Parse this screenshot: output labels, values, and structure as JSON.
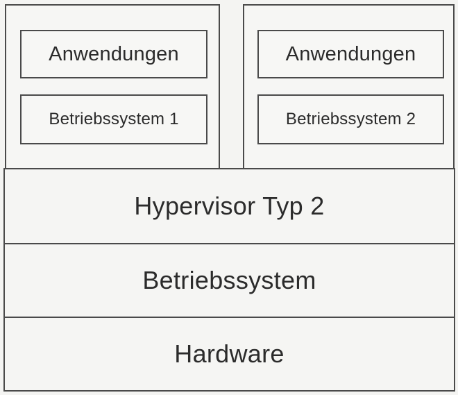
{
  "vm1": {
    "apps_label": "Anwendungen",
    "os_label": "Betriebssystem 1"
  },
  "vm2": {
    "apps_label": "Anwendungen",
    "os_label": "Betriebssystem 2"
  },
  "layers": {
    "hypervisor": "Hypervisor Typ 2",
    "host_os": "Betriebssystem",
    "hardware": "Hardware"
  }
}
